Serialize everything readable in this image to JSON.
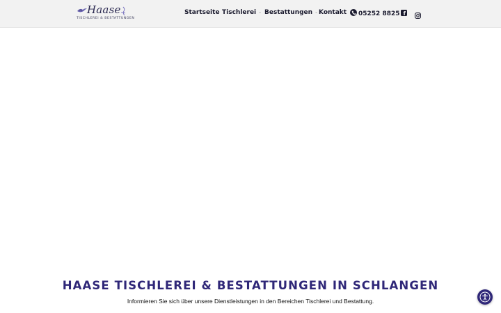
{
  "logo": {
    "script": "Haase",
    "subtitle": "TISCHLEREI & BESTATTUNGEN"
  },
  "nav": {
    "items": [
      {
        "label": "Startseite",
        "has_dropdown": false
      },
      {
        "label": "Tischlerei",
        "has_dropdown": true
      },
      {
        "label": "Bestattungen",
        "has_dropdown": true
      },
      {
        "label": "Kontakt",
        "has_dropdown": false
      }
    ],
    "phone": "05252 8825",
    "social_icons": [
      "facebook-icon",
      "instagram-icon"
    ]
  },
  "hero": {
    "heading": "HAASE TISCHLEREI & BESTATTUNGEN IN SCHLANGEN",
    "subtext": "Informieren Sie sich über unsere Dienstleistungen in den Bereichen Tischlerei und Bestattung."
  },
  "accessibility": {
    "icon": "accessibility-icon"
  },
  "colors": {
    "header_bg": "#f2f2f2",
    "nav_text": "#1a1a2e",
    "heading": "#2f2778",
    "accent": "#2f2778"
  }
}
